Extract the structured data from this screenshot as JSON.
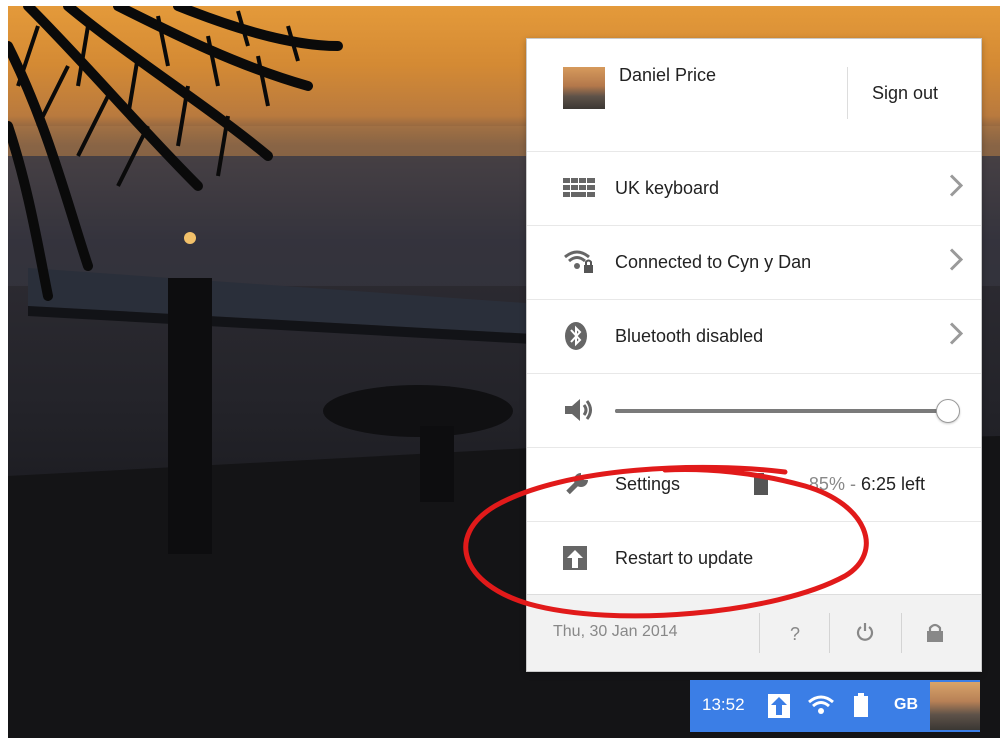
{
  "user": {
    "name": "Daniel Price",
    "sign_out_label": "Sign out"
  },
  "menu": {
    "keyboard": {
      "label": "UK keyboard",
      "icon": "keyboard-icon"
    },
    "network": {
      "label": "Connected to Cyn y Dan",
      "icon": "wifi-secure-icon"
    },
    "bluetooth": {
      "label": "Bluetooth disabled",
      "icon": "bluetooth-icon"
    },
    "volume": {
      "icon": "speaker-icon",
      "level_percent": 100
    },
    "settings": {
      "label": "Settings",
      "icon": "wrench-icon"
    },
    "battery": {
      "percent": "85%",
      "separator": " - ",
      "time_left": "6:25 left",
      "icon": "battery-icon"
    },
    "update": {
      "label": "Restart to update",
      "icon": "update-arrow-icon"
    }
  },
  "footer": {
    "date": "Thu, 30 Jan 2014",
    "help_label": "?",
    "power_icon": "power-icon",
    "lock_icon": "lock-icon"
  },
  "shelf": {
    "time": "13:52",
    "locale": "GB",
    "icons": [
      "update-arrow-icon",
      "wifi-icon",
      "battery-icon"
    ]
  },
  "colors": {
    "shelf_status": "#3b7ee6",
    "annotation": "#e11a1a",
    "menu_bg": "#ffffff",
    "footer_bg": "#f2f2f2"
  }
}
